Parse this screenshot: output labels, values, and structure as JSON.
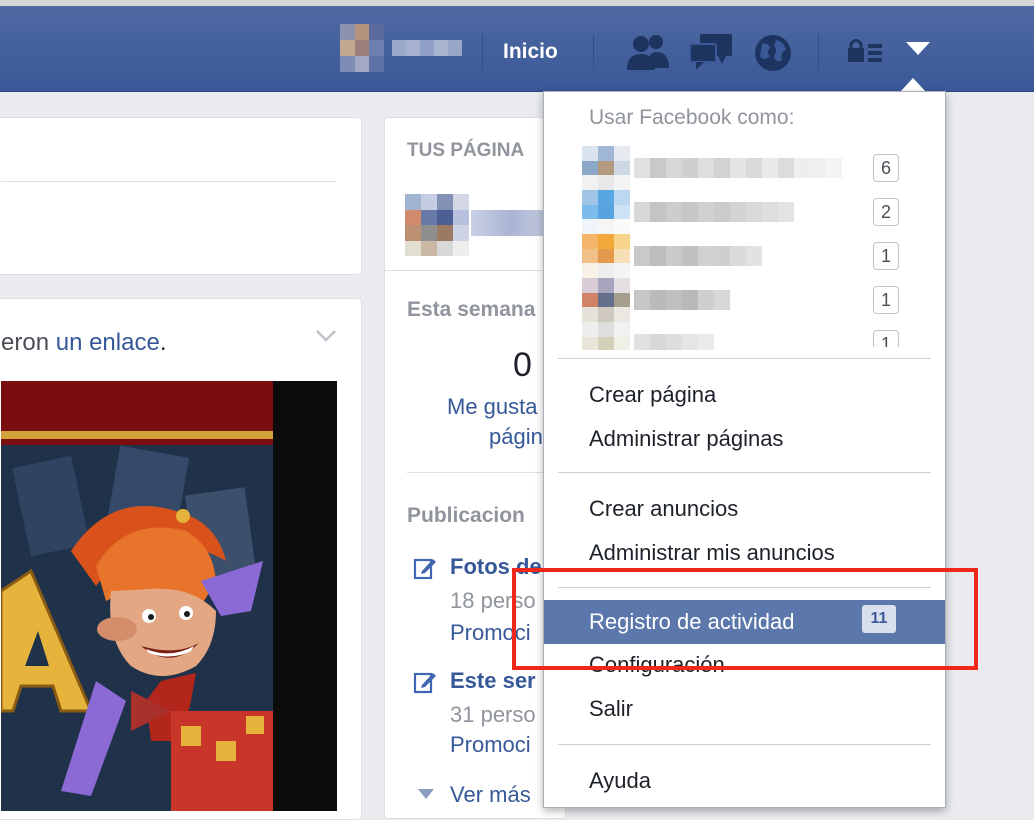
{
  "topbar": {
    "inicio_label": "Inicio",
    "icons": [
      "friend-requests-icon",
      "messages-icon",
      "notifications-globe-icon",
      "privacy-shortcuts-icon",
      "account-menu-caret-icon"
    ],
    "colors": {
      "bar": "#3b5998",
      "bar_border": "#29487d"
    }
  },
  "left_column": {
    "post_text_fragment": "eron",
    "post_link": "un enlace",
    "post_period": ".",
    "image_alt": "Juego con personaje bufón"
  },
  "right_column": {
    "pages_title": "TUS PÁGINA",
    "week_title": "Esta semana",
    "likes_count": "0",
    "likes_label_1": "Me gusta",
    "likes_label_2": "págin",
    "publications_title": "Publicacion",
    "posts": [
      {
        "title": "Fotos de",
        "subtitle": "18 perso",
        "promo": "Promoci"
      },
      {
        "title": "Este ser",
        "subtitle": "31 perso",
        "promo": "Promoci"
      }
    ],
    "see_more": "Ver más"
  },
  "dropdown": {
    "header": "Usar Facebook como:",
    "pages": [
      {
        "count": "6"
      },
      {
        "count": "2"
      },
      {
        "count": "1"
      },
      {
        "count": "1"
      },
      {
        "count": "1"
      }
    ],
    "section1": [
      "Crear página",
      "Administrar páginas"
    ],
    "section2": [
      "Crear anuncios",
      "Administrar mis anuncios"
    ],
    "activity_log": "Registro de actividad",
    "activity_badge": "11",
    "settings": "Configuración",
    "logout": "Salir",
    "help": "Ayuda",
    "colors": {
      "active_bg": "#5b77ab",
      "highlight": "#f0271b"
    }
  }
}
